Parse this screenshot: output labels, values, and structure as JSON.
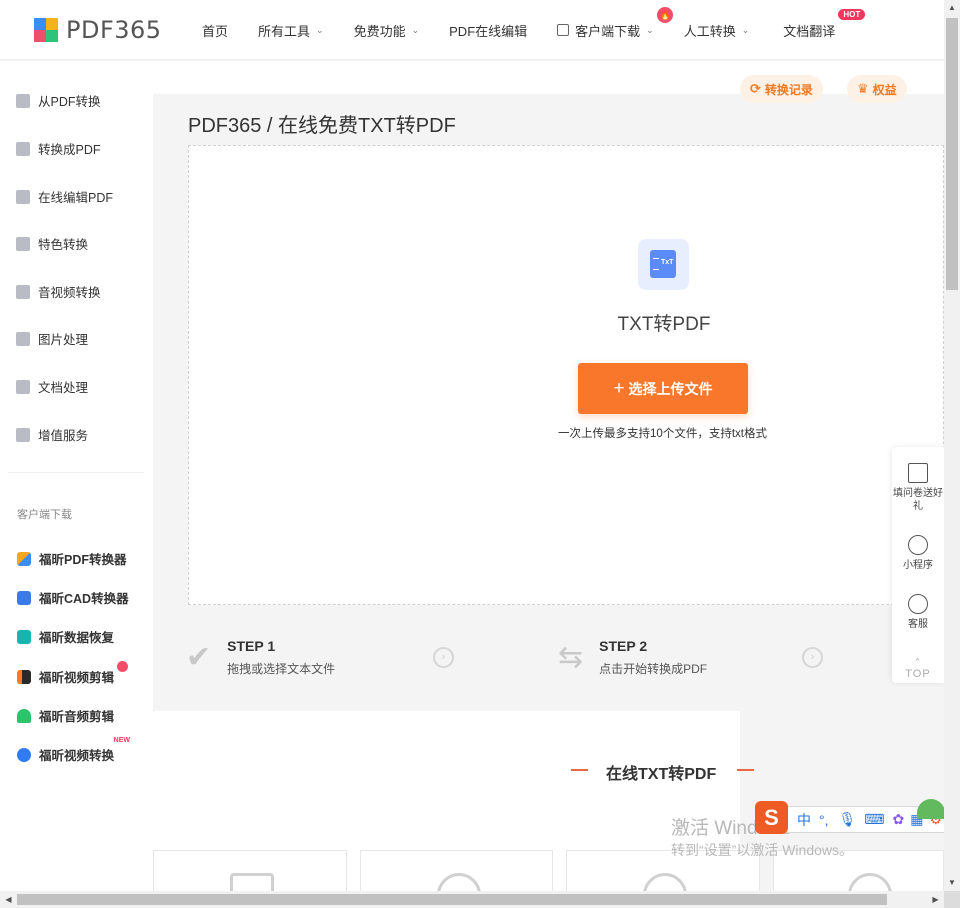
{
  "header": {
    "logo_text": "PDF365",
    "nav": [
      {
        "label": "首页"
      },
      {
        "label": "所有工具"
      },
      {
        "label": "免费功能"
      },
      {
        "label": "PDF在线编辑"
      },
      {
        "label": "客户端下载"
      },
      {
        "label": "人工转换"
      },
      {
        "label": "文档翻译",
        "badge": "HOT"
      }
    ]
  },
  "sidebar": {
    "items": [
      {
        "label": "从PDF转换"
      },
      {
        "label": "转换成PDF"
      },
      {
        "label": "在线编辑PDF"
      },
      {
        "label": "特色转换"
      },
      {
        "label": "音视频转换"
      },
      {
        "label": "图片处理"
      },
      {
        "label": "文档处理"
      },
      {
        "label": "增值服务"
      }
    ],
    "caption": "客户端下载",
    "clients": [
      {
        "label": "福昕PDF转换器",
        "color": "#f5a623"
      },
      {
        "label": "福昕CAD转换器",
        "color": "#3b7be8"
      },
      {
        "label": "福昕数据恢复",
        "color": "#17b4b0"
      },
      {
        "label": "福昕视频剪辑",
        "color": "#ff7a1a"
      },
      {
        "label": "福昕音频剪辑",
        "color": "#2cc46a"
      },
      {
        "label": "福昕视频转换",
        "color": "#2f7cf6",
        "badge": "NEW"
      }
    ]
  },
  "top_actions": {
    "records": "转换记录",
    "benefits": "权益"
  },
  "main": {
    "breadcrumb": "PDF365 / 在线免费TXT转PDF",
    "tool_name": "TXT转PDF",
    "upload_button": "选择上传文件",
    "upload_hint": "一次上传最多支持10个文件，支持txt格式",
    "steps": [
      {
        "title": "STEP 1",
        "desc": "拖拽或选择文本文件"
      },
      {
        "title": "STEP 2",
        "desc": "点击开始转换成PDF"
      }
    ],
    "section_title": "在线TXT转PDF"
  },
  "float_bar": {
    "survey": "填问卷送好礼",
    "miniapp": "小程序",
    "service": "客服",
    "top": "TOP"
  },
  "watermark": {
    "line1": "激活 Windows",
    "line2": "转到“设置”以激活 Windows。"
  },
  "ime": {
    "logo": "S",
    "mode": "中"
  },
  "colors": {
    "accent": "#f8772a",
    "pill_bg": "#fdf1e6",
    "pill_text": "#f07a23"
  }
}
